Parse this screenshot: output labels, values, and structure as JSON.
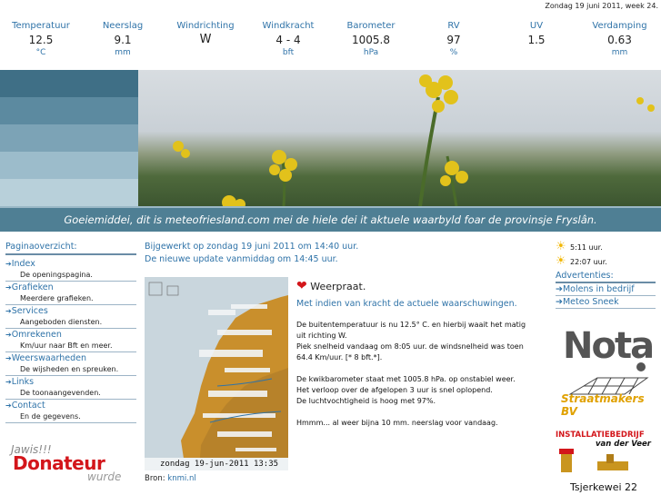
{
  "date_line": "Zondag 19 juni 2011, week 24.",
  "weather": [
    {
      "label": "Temperatuur",
      "value": "12.5",
      "unit": "°C"
    },
    {
      "label": "Neerslag",
      "value": "9.1",
      "unit": "mm"
    },
    {
      "label": "Windrichting",
      "value": "W",
      "unit": ""
    },
    {
      "label": "Windkracht",
      "value": "4 - 4",
      "unit": "bft"
    },
    {
      "label": "Barometer",
      "value": "1005.8",
      "unit": "hPa"
    },
    {
      "label": "RV",
      "value": "97",
      "unit": "%"
    },
    {
      "label": "UV",
      "value": "1.5",
      "unit": ""
    },
    {
      "label": "Verdamping",
      "value": "0.63",
      "unit": "mm"
    }
  ],
  "banner": {
    "tagline": "Goeiemiddei, dit is meteofriesland.com mei de hiele dei it aktuele waarbyld foar de provinsje Fryslân."
  },
  "nav": {
    "heading": "Paginaoverzicht:",
    "items": [
      {
        "title": "Index",
        "desc": "De openingspagina."
      },
      {
        "title": "Grafieken",
        "desc": "Meerdere grafieken."
      },
      {
        "title": "Services",
        "desc": "Aangeboden diensten."
      },
      {
        "title": "Omrekenen",
        "desc": "Km/uur naar Bft en meer."
      },
      {
        "title": "Weerswaarheden",
        "desc": "De wijsheden en spreuken."
      },
      {
        "title": "Links",
        "desc": "De toonaangevenden."
      },
      {
        "title": "Contact",
        "desc": "En de gegevens."
      }
    ]
  },
  "donateur": {
    "line1": "Jawis!!!",
    "line2": "Donateur",
    "line3": "wurde"
  },
  "update": {
    "line1": "Bijgewerkt op zondag 19 juni 2011 om 14:40 uur.",
    "line2": "De nieuwe update vanmiddag om 14:45 uur."
  },
  "radar": {
    "stamp": "zondag 19-jun-2011 13:35 LT",
    "source_label": "Bron:",
    "source_link": "knmi.nl"
  },
  "weerpraat": {
    "title": "Weerpraat.",
    "subtitle": "Met indien van kracht de actuele waarschuwingen.",
    "p1a": "De buitentemperatuur is nu 12.5° C. en hierbij waait het matig uit richting W.",
    "p1b": "Piek snelheid vandaag om 8:05 uur. de windsnelheid was toen 64.4 Km/uur. [* 8 bft.*].",
    "p2a": "De kwikbarometer staat met 1005.8 hPa. op onstabiel weer.",
    "p2b": "Het verloop over de afgelopen 3 uur is snel oplopend.",
    "p2c": "De luchtvochtigheid is hoog met 97%.",
    "p3": "Hmmm... al weer bijna 10 mm. neerslag voor vandaag."
  },
  "sun": {
    "rise": "5:11 uur.",
    "set": "22:07 uur."
  },
  "ads": {
    "heading": "Advertenties:",
    "links": [
      "Molens in bedrijf",
      "Meteo Sneek"
    ],
    "nota_word": "Nota",
    "nota_strip": "Straatmakers BV",
    "inst_line1_red": "IN",
    "inst_line1": "STALLATIEBEDRIJF",
    "inst_line2": "van der Veer",
    "inst_line3": "Tsjerkewei 22"
  },
  "colors": {
    "link": "#2f73a8",
    "accent_red": "#d3161b",
    "banner_bar": "#4f7f94"
  }
}
